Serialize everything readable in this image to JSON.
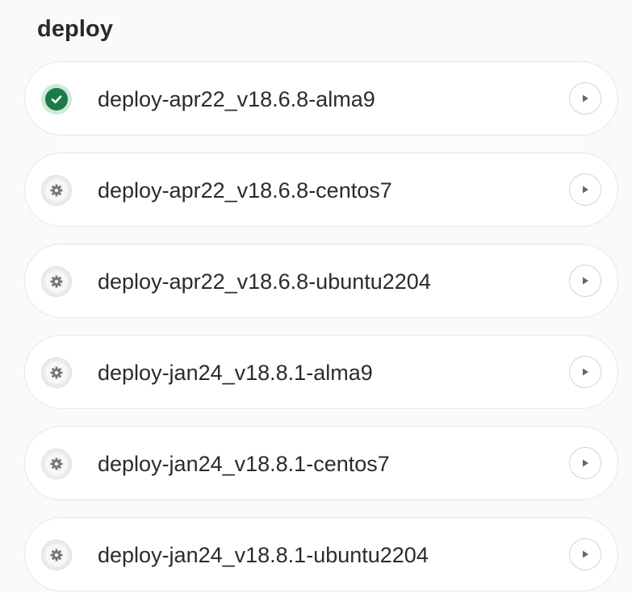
{
  "stage": {
    "title": "deploy"
  },
  "jobs": [
    {
      "name": "deploy-apr22_v18.6.8-alma9",
      "status": "success",
      "status_icon": "check-circle-icon",
      "action_icon": "play-icon"
    },
    {
      "name": "deploy-apr22_v18.6.8-centos7",
      "status": "manual",
      "status_icon": "gear-icon",
      "action_icon": "play-icon"
    },
    {
      "name": "deploy-apr22_v18.6.8-ubuntu2204",
      "status": "manual",
      "status_icon": "gear-icon",
      "action_icon": "play-icon"
    },
    {
      "name": "deploy-jan24_v18.8.1-alma9",
      "status": "manual",
      "status_icon": "gear-icon",
      "action_icon": "play-icon"
    },
    {
      "name": "deploy-jan24_v18.8.1-centos7",
      "status": "manual",
      "status_icon": "gear-icon",
      "action_icon": "play-icon"
    },
    {
      "name": "deploy-jan24_v18.8.1-ubuntu2204",
      "status": "manual",
      "status_icon": "gear-icon",
      "action_icon": "play-icon"
    }
  ],
  "colors": {
    "success": "#1a7a48",
    "success_halo": "#cfe9d8",
    "manual_icon": "#777777",
    "play_icon": "#666666",
    "text": "#2b2b2b"
  }
}
